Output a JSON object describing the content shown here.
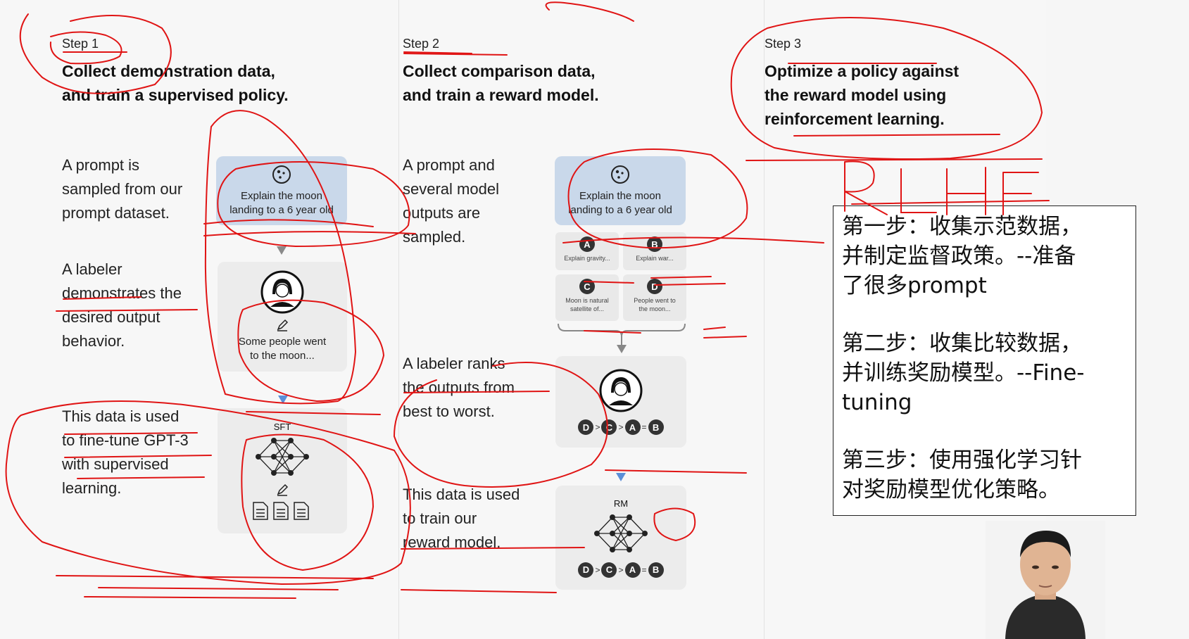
{
  "steps": [
    {
      "label": "Step 1",
      "title_lines": [
        "Collect demonstration data,",
        "and train a supervised policy."
      ],
      "desc1": [
        "A prompt is",
        "sampled from our",
        "prompt dataset."
      ],
      "prompt_card": [
        "Explain the moon",
        "landing to a 6 year old"
      ],
      "desc2": [
        "A labeler",
        "demonstrates the",
        "desired output",
        "behavior."
      ],
      "labeler_card": [
        "Some people went",
        "to the moon..."
      ],
      "desc3": [
        "This data is used",
        "to fine-tune GPT-3",
        "with supervised",
        "learning."
      ],
      "model_label": "SFT"
    },
    {
      "label": "Step 2",
      "title_lines": [
        "Collect comparison data,",
        "and train a reward model."
      ],
      "desc1": [
        "A prompt and",
        "several model",
        "outputs are",
        "sampled."
      ],
      "prompt_card": [
        "Explain the moon",
        "landing to a 6 year old"
      ],
      "outputs": [
        {
          "letter": "A",
          "text": [
            "Explain gravity..."
          ]
        },
        {
          "letter": "B",
          "text": [
            "Explain war..."
          ]
        },
        {
          "letter": "C",
          "text": [
            "Moon is natural",
            "satellite of..."
          ]
        },
        {
          "letter": "D",
          "text": [
            "People went to",
            "the moon..."
          ]
        }
      ],
      "desc2": [
        "A labeler ranks",
        "the outputs from",
        "best to worst."
      ],
      "ranking": [
        "D",
        ">",
        "C",
        ">",
        "A",
        "=",
        "B"
      ],
      "desc3": [
        "This data is used",
        "to train our",
        "reward model."
      ],
      "model_label": "RM"
    },
    {
      "label": "Step 3",
      "title_lines": [
        "Optimize a policy against",
        "the reward model using",
        "reinforcement learning."
      ]
    }
  ],
  "handwriting": "RLHF",
  "note": {
    "para1": [
      "第一步：收集示范数据，",
      "并制定监督政策。--准备",
      "了很多prompt"
    ],
    "para2": [
      "第二步：收集比较数据，",
      "并训练奖励模型。--Fine-",
      "tuning"
    ],
    "para3": [
      "第三步：使用强化学习针",
      "对奖励模型优化策略。"
    ]
  },
  "colors": {
    "annotation": "#e01414",
    "card_blue": "#c9d8ea",
    "card_gray": "#ececec",
    "arrow_blue": "#5a8fd8"
  }
}
